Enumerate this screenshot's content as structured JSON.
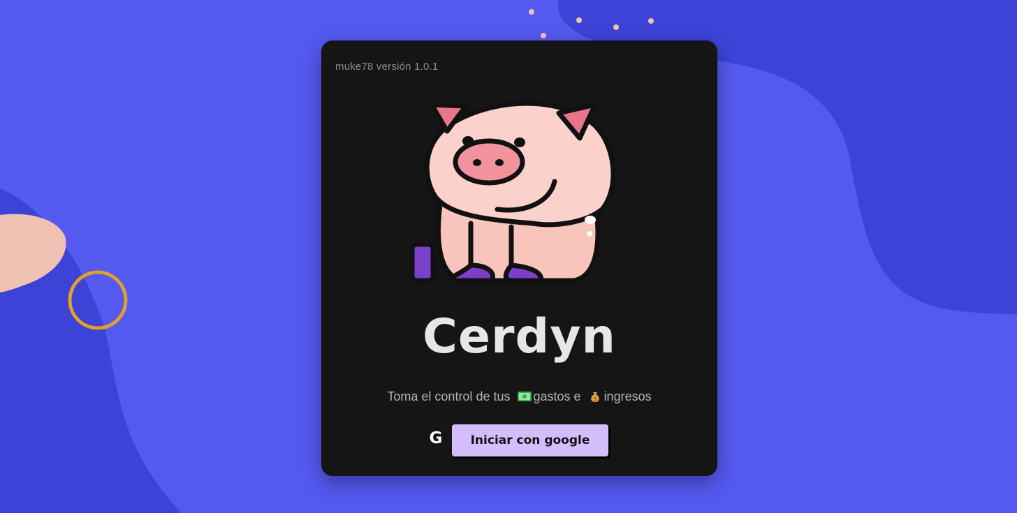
{
  "app": {
    "version_label": "muke78 versión 1.0.1",
    "title": "Cerdyn",
    "tagline": {
      "part1": "Toma el control de tus",
      "part2": "gastos e",
      "part3": "ingresos"
    },
    "login_button": "Iniciar con google",
    "google_glyph": "G"
  },
  "icons": {
    "logo": "pig-mascot-icon",
    "expenses": "money-bill-icon",
    "income": "money-bag-icon",
    "google": "google-icon"
  },
  "colors": {
    "background": "#5459f0",
    "background_dark": "#3d43d6",
    "card": "#151515",
    "button": "#d4bdfb",
    "accent_ring": "#e0a12a",
    "blob_peach": "#efc2b4"
  }
}
